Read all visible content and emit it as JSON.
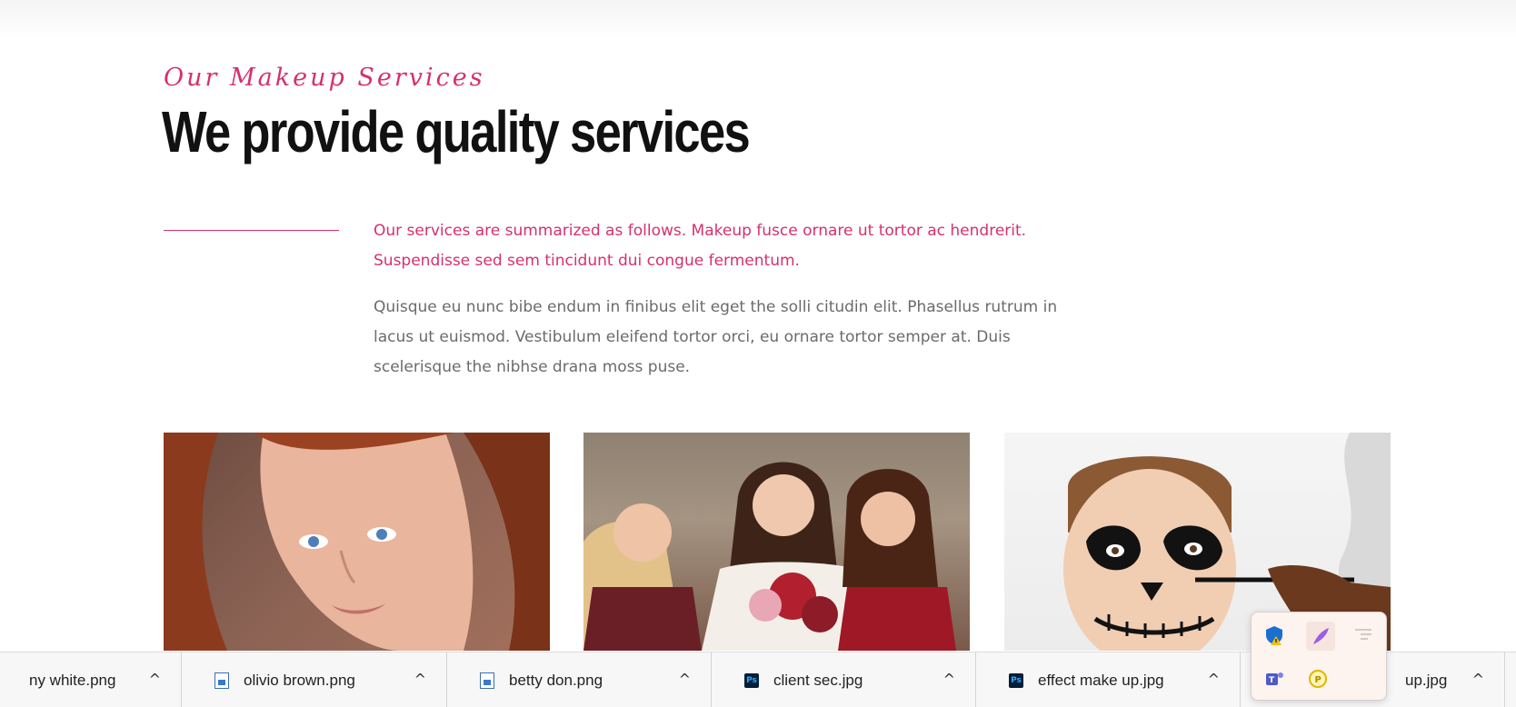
{
  "section": {
    "kicker": "Our Makeup Services",
    "headline": "We provide quality services",
    "lead": "Our services are summarized as follows.  Makeup fusce ornare ut tortor ac hendrerit. Suspendisse sed sem tincidunt dui congue fermentum.",
    "body": "Quisque eu nunc bibe endum in finibus elit eget the solli citudin elit.  Phasellus rutrum in lacus ut euismod. Vestibulum eleifend tortor orci, eu ornare tortor semper at.  Duis scelerisque the nibhse drana moss puse."
  },
  "colors": {
    "accent": "#d6306f",
    "heading": "#111111",
    "body": "#6b6b6b"
  },
  "downloads": [
    {
      "name": "ny white.png",
      "icon": "image-file-icon"
    },
    {
      "name": "olivio brown.png",
      "icon": "image-file-icon"
    },
    {
      "name": "betty don.png",
      "icon": "image-file-icon"
    },
    {
      "name": "client sec.jpg",
      "icon": "photoshop-icon"
    },
    {
      "name": "effect make up.jpg",
      "icon": "photoshop-icon"
    },
    {
      "name": "up.jpg",
      "icon": "photoshop-icon"
    }
  ],
  "ps_badge": "Ps",
  "chevron": "^",
  "tray": {
    "icons": [
      "security-warning-icon",
      "feather-icon",
      "notification-icon",
      "teams-icon",
      "coin-icon"
    ]
  }
}
